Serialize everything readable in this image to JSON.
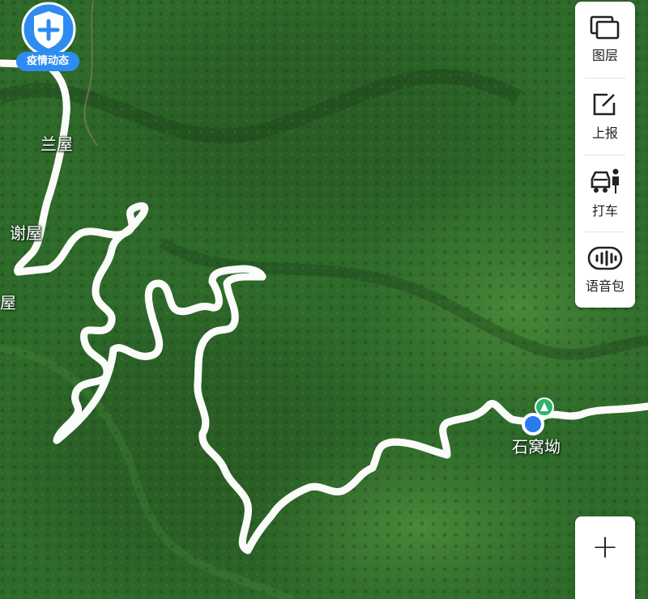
{
  "map": {
    "route_color": "#7be3b8",
    "terrain_color": "#2f6b2a",
    "places": [
      {
        "name": "兰屋"
      },
      {
        "name": "谢屋"
      },
      {
        "name": "屋"
      },
      {
        "name": "石窝坳"
      }
    ]
  },
  "badge": {
    "label": "疫情动态",
    "icon": "shield-plus-icon"
  },
  "toolbar": {
    "items": [
      {
        "label": "图层",
        "icon": "layers-icon"
      },
      {
        "label": "上报",
        "icon": "edit-report-icon"
      },
      {
        "label": "打车",
        "icon": "taxi-icon"
      },
      {
        "label": "语音包",
        "icon": "voice-pack-icon"
      }
    ]
  },
  "zoom": {
    "in_label": "+"
  }
}
